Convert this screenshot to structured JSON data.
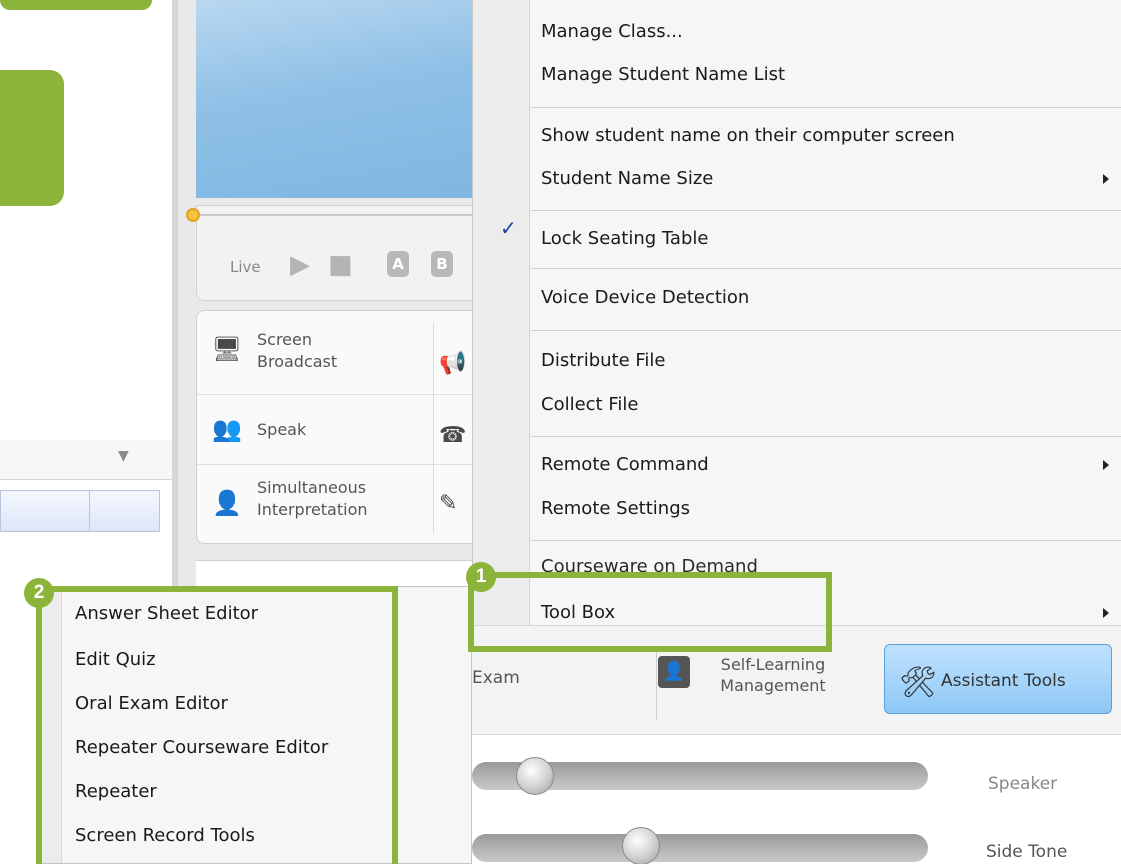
{
  "player": {
    "live_label": "Live",
    "btn_a": "A",
    "btn_b": "B"
  },
  "functions": {
    "screen_broadcast": "Screen Broadcast",
    "speak": "Speak",
    "simultaneous": "Simultaneous Interpretation"
  },
  "context_menu": {
    "items": [
      "Manage Class...",
      "Manage Student Name List",
      "Show student name on their computer screen",
      "Student Name Size",
      "Lock Seating Table",
      "Voice Device Detection",
      "Distribute File",
      "Collect File",
      "Remote Command",
      "Remote Settings",
      "Courseware on Demand",
      "Tool Box"
    ],
    "checked_item": "Lock Seating Table"
  },
  "submenu": {
    "items": [
      "Answer Sheet Editor",
      "Edit Quiz",
      "Oral Exam Editor",
      "Repeater Courseware Editor",
      "Repeater",
      "Screen Record Tools"
    ]
  },
  "toolbar": {
    "exam_label": "Exam",
    "self_learning_label": "Self-Learning Management",
    "assistant_tools_label": "Assistant Tools"
  },
  "sliders": {
    "speaker_label": "Speaker",
    "side_tone_label": "Side Tone",
    "speaker_level": 0.15,
    "side_tone_level": 0.38
  },
  "badges": {
    "one": "1",
    "two": "2"
  },
  "colors": {
    "annotation_green": "#8db43a",
    "assistant_blue": "#8ec8f5",
    "check_blue": "#1a3fa0"
  }
}
